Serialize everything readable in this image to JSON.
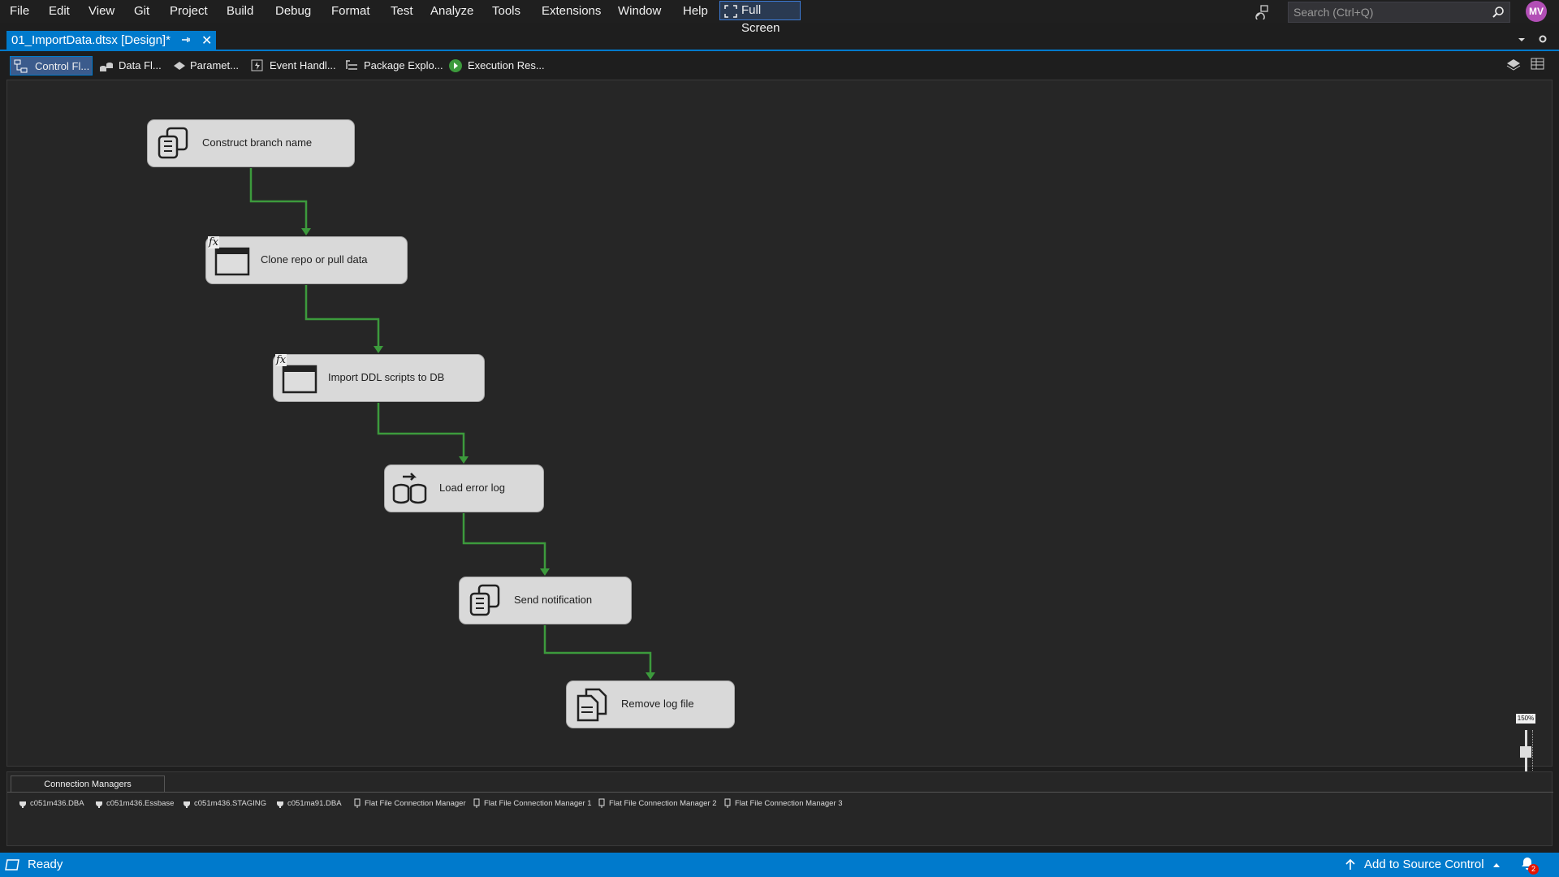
{
  "menu": [
    "File",
    "Edit",
    "View",
    "Git",
    "Project",
    "Build",
    "Debug",
    "Format",
    "Test",
    "Analyze",
    "Tools",
    "Extensions",
    "Window",
    "Help"
  ],
  "fullscreen_label": "Full Screen",
  "search_placeholder": "Search (Ctrl+Q)",
  "user_initials": "MV",
  "document_tab": {
    "title": "01_ImportData.dtsx [Design]*",
    "close": "✕"
  },
  "designer_tabs": [
    {
      "label": "Control Fl...",
      "icon": "control-flow-icon"
    },
    {
      "label": "Data Fl...",
      "icon": "data-flow-icon"
    },
    {
      "label": "Paramet...",
      "icon": "parameters-icon"
    },
    {
      "label": "Event Handl...",
      "icon": "event-handlers-icon"
    },
    {
      "label": "Package Explo...",
      "icon": "package-explorer-icon"
    },
    {
      "label": "Execution Res...",
      "icon": "execution-results-icon"
    }
  ],
  "tasks": [
    {
      "label": "Construct  branch name",
      "icon": "script-task-icon",
      "expression": false
    },
    {
      "label": "Clone repo or pull data",
      "icon": "execute-process-icon",
      "expression": true
    },
    {
      "label": "Import DDL scripts to DB",
      "icon": "execute-process-icon",
      "expression": true
    },
    {
      "label": "Load error log",
      "icon": "data-flow-task-icon",
      "expression": false
    },
    {
      "label": "Send notification",
      "icon": "script-task-icon",
      "expression": false
    },
    {
      "label": "Remove log file",
      "icon": "file-system-task-icon",
      "expression": false
    }
  ],
  "expression_marker": "fx",
  "zoom": {
    "label": "150%",
    "level": 0.75
  },
  "connection_managers": {
    "tab_label": "Connection Managers",
    "items": [
      "c051m436.DBA",
      "c051m436.Essbase",
      "c051m436.STAGING",
      "c051ma91.DBA",
      "Flat File Connection Manager",
      "Flat File Connection Manager 1",
      "Flat File Connection Manager 2",
      "Flat File Connection Manager 3"
    ]
  },
  "status": {
    "ready": "Ready",
    "source_control": "Add to Source Control",
    "notifications": "2"
  },
  "colors": {
    "accent": "#007acc",
    "flow_line": "#3c9a3c",
    "task_bg": "#d9d9d9"
  }
}
